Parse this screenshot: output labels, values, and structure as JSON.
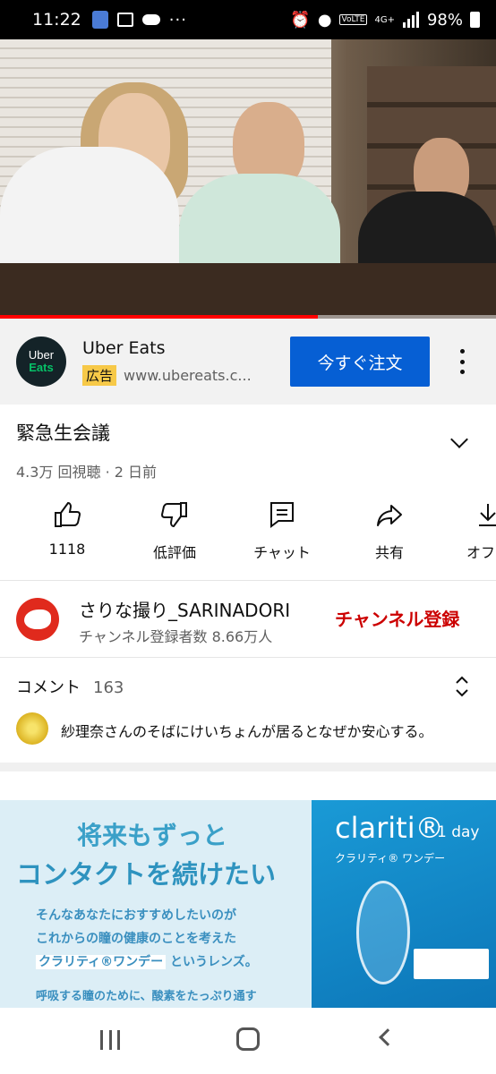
{
  "status_bar": {
    "time": "11:22",
    "more": "···",
    "network_badge": "VoLTE",
    "network_type": "4G+",
    "battery": "98%"
  },
  "video": {
    "progress": 0.64
  },
  "ad": {
    "advertiser": "Uber Eats",
    "logo_line1": "Uber",
    "logo_line2": "Eats",
    "badge": "広告",
    "url": "www.ubereats.c...",
    "cta": "今すぐ注文"
  },
  "video_info": {
    "title": "緊急生会議",
    "meta": "4.3万 回視聴 · 2 日前"
  },
  "actions": [
    {
      "label": "1118",
      "icon": "thumbs-up-icon"
    },
    {
      "label": "低評価",
      "icon": "thumbs-down-icon"
    },
    {
      "label": "チャット",
      "icon": "chat-icon"
    },
    {
      "label": "共有",
      "icon": "share-icon"
    },
    {
      "label": "オフラ",
      "icon": "download-icon"
    }
  ],
  "channel": {
    "name": "さりな撮り_SARINADORI",
    "subscribers": "チャンネル登録者数 8.66万人",
    "subscribe": "チャンネル登録"
  },
  "comments": {
    "label": "コメント",
    "count": "163",
    "top_comment": "紗理奈さんのそばにけいちょんが居るとなぜか安心する。"
  },
  "banner": {
    "headline1": "将来もずっと",
    "headline2": "コンタクトを続けたい",
    "line1": "そんなあなたにおすすめしたいのが",
    "line2": "これからの瞳の健康のことを考えた",
    "line3_highlight": "クラリティ®ワンデー",
    "line3_rest": "というレンズ。",
    "line4": "呼吸する瞳のために、酸素をたっぷり通す",
    "brand": "clariti®",
    "brand_day": "1 day",
    "brand_sub": "クラリティ® ワンデー"
  },
  "colors": {
    "cta_blue": "#065fd4",
    "subscribe_red": "#cc0000",
    "progress_red": "#ff0000",
    "ad_badge": "#f7c948"
  }
}
